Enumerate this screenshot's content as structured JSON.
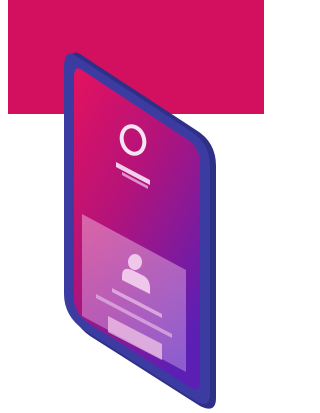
{
  "illustration": {
    "subject": "isometric-smartphone",
    "colors": {
      "banner": "#d3105f",
      "phone_frame": "#3a3aa0",
      "screen_top": "#e4125f",
      "screen_bottom": "#6a1bb0",
      "ui_light": "#f1c6e6"
    },
    "icons": [
      "user-ring-icon",
      "person-avatar-icon"
    ]
  }
}
